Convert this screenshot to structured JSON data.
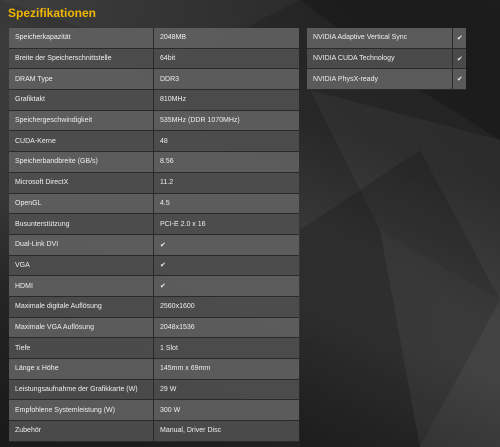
{
  "page": {
    "title": "Spezifikationen"
  },
  "specs_left": [
    {
      "label": "Speicherkapazität",
      "value": "2048MB"
    },
    {
      "label": "Breite der Speicherschnittstelle",
      "value": "64bit"
    },
    {
      "label": "DRAM Type",
      "value": "DDR3"
    },
    {
      "label": "Grafiktakt",
      "value": "810MHz"
    },
    {
      "label": "Speichergeschwindigkeit",
      "value": "535MHz (DDR 1070MHz)"
    },
    {
      "label": "CUDA-Kerne",
      "value": "48"
    },
    {
      "label": "Speicherbandbreite (GB/s)",
      "value": "8.56"
    },
    {
      "label": "Microsoft DirectX",
      "value": "11.2"
    },
    {
      "label": "OpenGL",
      "value": "4.5"
    },
    {
      "label": "Busunterstützung",
      "value": "PCI-E 2.0 x 16"
    },
    {
      "label": "Dual-Link DVI",
      "value": "✔"
    },
    {
      "label": "VGA",
      "value": "✔"
    },
    {
      "label": "HDMI",
      "value": "✔"
    },
    {
      "label": "Maximale digitale Auflösung",
      "value": "2560x1600"
    },
    {
      "label": "Maximale VGA Auflösung",
      "value": "2048x1536"
    },
    {
      "label": "Tiefe",
      "value": "1 Slot"
    },
    {
      "label": "Länge x Höhe",
      "value": "145mm x 69mm"
    },
    {
      "label": "Leistungsaufnahme der Grafikkarte (W)",
      "value": "29 W"
    },
    {
      "label": "Empfohlene Systemleistung (W)",
      "value": "300 W"
    },
    {
      "label": "Zubehör",
      "value": "Manual, Driver Disc"
    }
  ],
  "specs_right": [
    {
      "label": "NVIDIA Adaptive Vertical Sync",
      "value": "✔"
    },
    {
      "label": "NVIDIA CUDA Technology",
      "value": "✔"
    },
    {
      "label": "NVIDIA PhysX-ready",
      "value": "✔"
    }
  ]
}
